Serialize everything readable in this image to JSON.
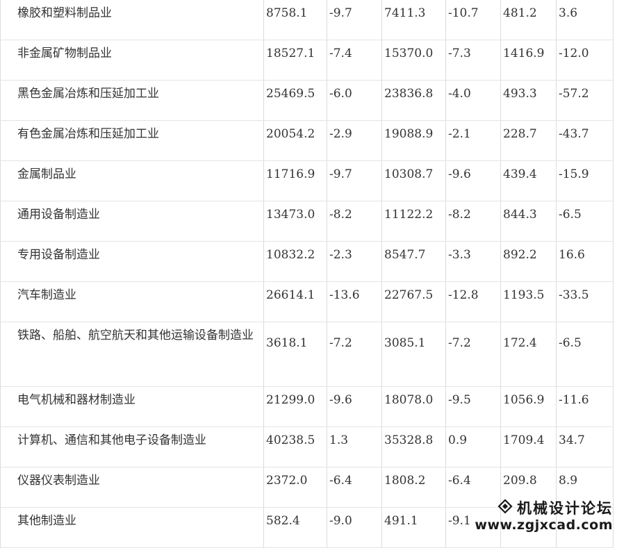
{
  "rows": [
    {
      "name": "橡胶和塑料制品业",
      "v1": "8758.1",
      "v2": "-9.7",
      "v3": "7411.3",
      "v4": "-10.7",
      "v5": "481.2",
      "v6": "3.6"
    },
    {
      "name": "非金属矿物制品业",
      "v1": "18527.1",
      "v2": "-7.4",
      "v3": "15370.0",
      "v4": "-7.3",
      "v5": "1416.9",
      "v6": "-12.0"
    },
    {
      "name": "黑色金属冶炼和压延加工业",
      "v1": "25469.5",
      "v2": "-6.0",
      "v3": "23836.8",
      "v4": "-4.0",
      "v5": "493.3",
      "v6": "-57.2"
    },
    {
      "name": "有色金属冶炼和压延加工业",
      "v1": "20054.2",
      "v2": "-2.9",
      "v3": "19088.9",
      "v4": "-2.1",
      "v5": "228.7",
      "v6": "-43.7"
    },
    {
      "name": "金属制品业",
      "v1": "11716.9",
      "v2": "-9.7",
      "v3": "10308.7",
      "v4": "-9.6",
      "v5": "439.4",
      "v6": "-15.9"
    },
    {
      "name": "通用设备制造业",
      "v1": "13473.0",
      "v2": "-8.2",
      "v3": "11122.2",
      "v4": "-8.2",
      "v5": "844.3",
      "v6": "-6.5"
    },
    {
      "name": "专用设备制造业",
      "v1": "10832.2",
      "v2": "-2.3",
      "v3": "8547.7",
      "v4": "-3.3",
      "v5": "892.2",
      "v6": "16.6"
    },
    {
      "name": "汽车制造业",
      "v1": "26614.1",
      "v2": "-13.6",
      "v3": "22767.5",
      "v4": "-12.8",
      "v5": "1193.5",
      "v6": "-33.5"
    },
    {
      "name": "铁路、船舶、航空航天和其他运输设备制造业",
      "v1": "3618.1",
      "v2": "-7.2",
      "v3": "3085.1",
      "v4": "-7.2",
      "v5": "172.4",
      "v6": "-6.5"
    },
    {
      "name": "电气机械和器材制造业",
      "v1": "21299.0",
      "v2": "-9.6",
      "v3": "18078.0",
      "v4": "-9.5",
      "v5": "1056.9",
      "v6": "-11.6"
    },
    {
      "name": "计算机、通信和其他电子设备制造业",
      "v1": "40238.5",
      "v2": "1.3",
      "v3": "35328.8",
      "v4": "0.9",
      "v5": "1709.4",
      "v6": "34.7"
    },
    {
      "name": "仪器仪表制造业",
      "v1": "2372.0",
      "v2": "-6.4",
      "v3": "1808.2",
      "v4": "-6.4",
      "v5": "209.8",
      "v6": "8.9"
    },
    {
      "name": "其他制造业",
      "v1": "582.4",
      "v2": "-9.0",
      "v3": "491.1",
      "v4": "-9.1",
      "v5": "",
      "v6": ""
    }
  ],
  "watermark": {
    "logo_icon": "diamond-logo-icon",
    "title": "机械设计论坛",
    "url": "www.zgjxcad.com"
  }
}
